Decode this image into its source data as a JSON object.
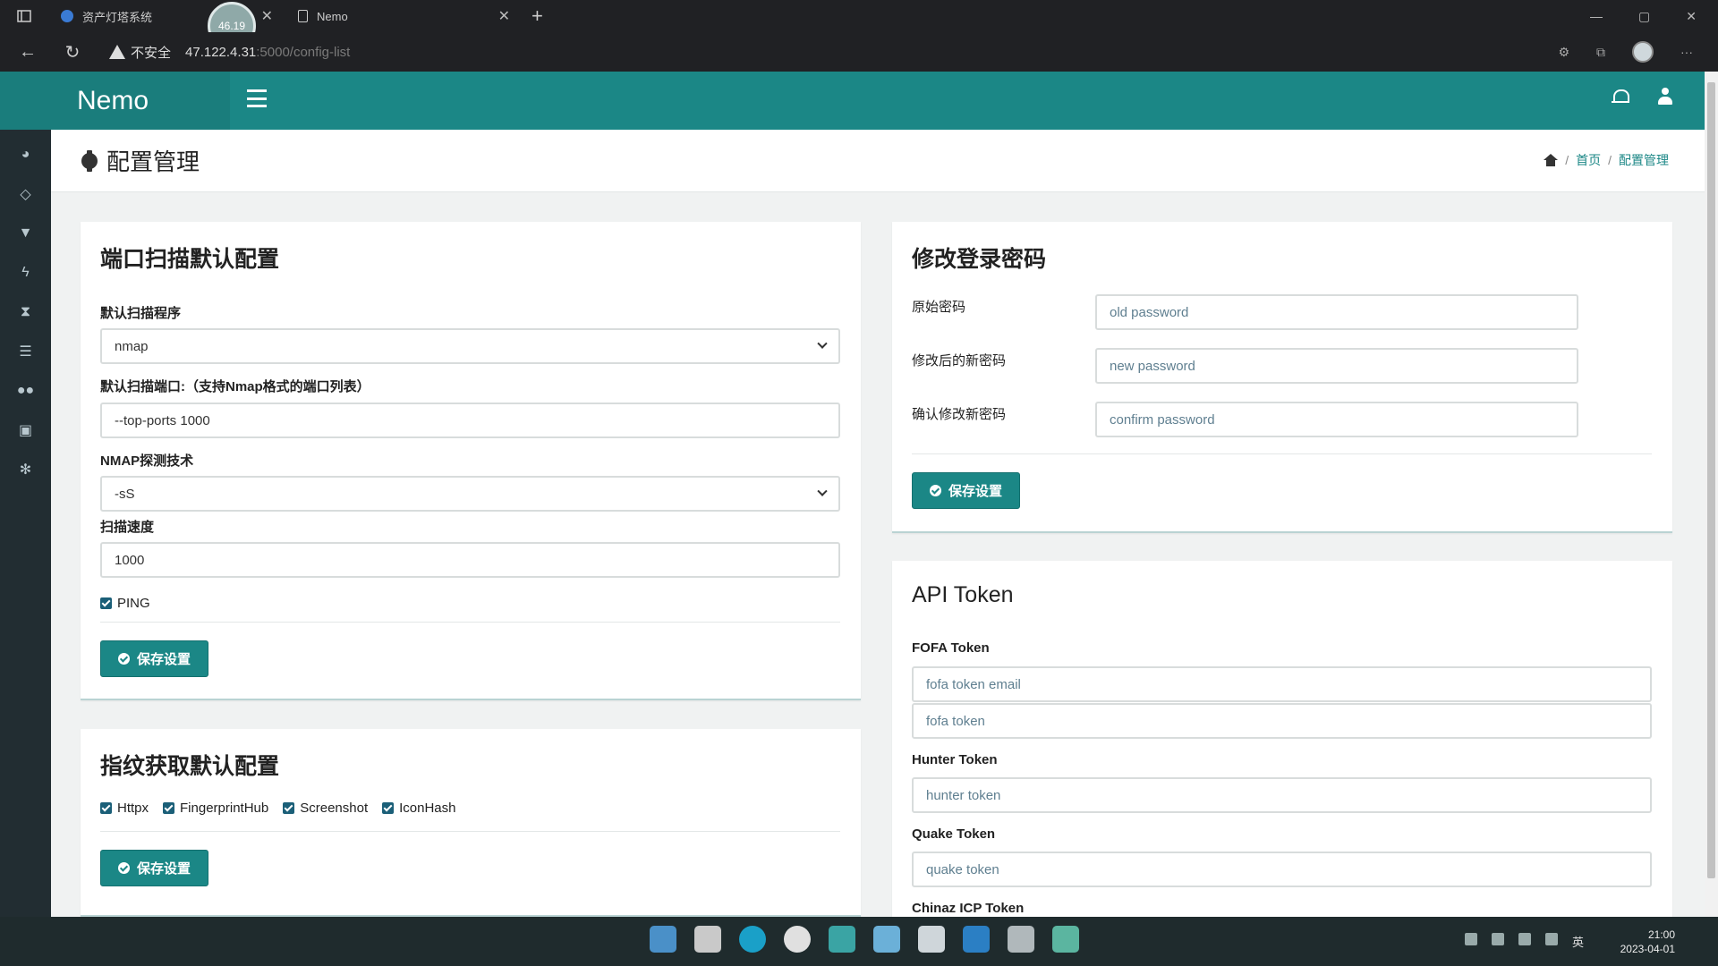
{
  "browser": {
    "tabs": [
      {
        "title": "资产灯塔系统"
      },
      {
        "title": "Nemo"
      }
    ],
    "badge": "46.19",
    "insecure_label": "不安全",
    "url_host": "47.122.4.31",
    "url_path": ":5000/config-list",
    "new_tab": "+",
    "more": "···"
  },
  "app": {
    "brand": "Nemo"
  },
  "page": {
    "title": "配置管理",
    "breadcrumb": {
      "home": "首页",
      "current": "配置管理"
    }
  },
  "port_scan": {
    "title": "端口扫描默认配置",
    "program_label": "默认扫描程序",
    "program_value": "nmap",
    "ports_label": "默认扫描端口:（支持Nmap格式的端口列表）",
    "ports_value": "--top-ports 1000",
    "tech_label": "NMAP探测技术",
    "tech_value": "-sS",
    "speed_label": "扫描速度",
    "speed_value": "1000",
    "ping_label": "PING",
    "save_label": "保存设置"
  },
  "fingerprint": {
    "title": "指纹获取默认配置",
    "options": [
      "Httpx",
      "FingerprintHub",
      "Screenshot",
      "IconHash"
    ],
    "save_label": "保存设置"
  },
  "password": {
    "title": "修改登录密码",
    "old_label": "原始密码",
    "old_placeholder": "old password",
    "new_label": "修改后的新密码",
    "new_placeholder": "new password",
    "confirm_label": "确认修改新密码",
    "confirm_placeholder": "confirm password",
    "save_label": "保存设置"
  },
  "api_token": {
    "title": "API Token",
    "fofa_label": "FOFA Token",
    "fofa_email_placeholder": "fofa token email",
    "fofa_token_placeholder": "fofa token",
    "hunter_label": "Hunter Token",
    "hunter_placeholder": "hunter token",
    "quake_label": "Quake Token",
    "quake_placeholder": "quake token",
    "chinaz_label": "Chinaz ICP Token"
  },
  "taskbar": {
    "time": "21:00",
    "date": "2023-04-01",
    "ime": "英"
  },
  "colors": {
    "primary": "#1b8786",
    "sidebar": "#222d32",
    "brand_bg": "#1a7d7c"
  }
}
